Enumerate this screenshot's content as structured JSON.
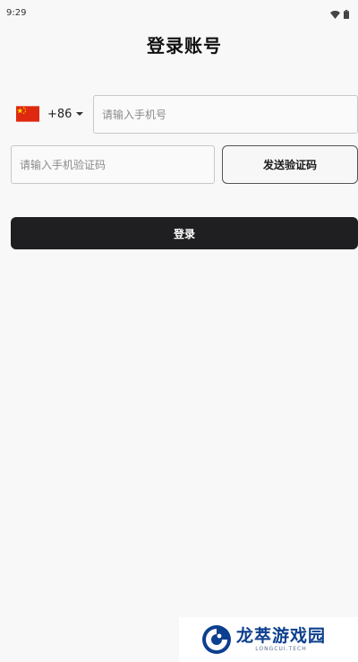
{
  "status_bar": {
    "time": "9:29",
    "icons": [
      "wifi-icon",
      "battery-icon"
    ]
  },
  "page_title": "登录账号",
  "country_picker": {
    "flag": "china-flag-icon",
    "code": "+86"
  },
  "phone_input": {
    "value": "",
    "placeholder": "请输入手机号"
  },
  "code_input": {
    "value": "",
    "placeholder": "请输入手机验证码"
  },
  "send_code_label": "发送验证码",
  "login_label": "登录",
  "watermark": {
    "name": "龙萃游戏园",
    "sub": "LONGCUI.TECH"
  },
  "colors": {
    "background": "#f8f8f8",
    "login_button": "#1f1f21",
    "watermark_blue": "#0d3f8f"
  }
}
